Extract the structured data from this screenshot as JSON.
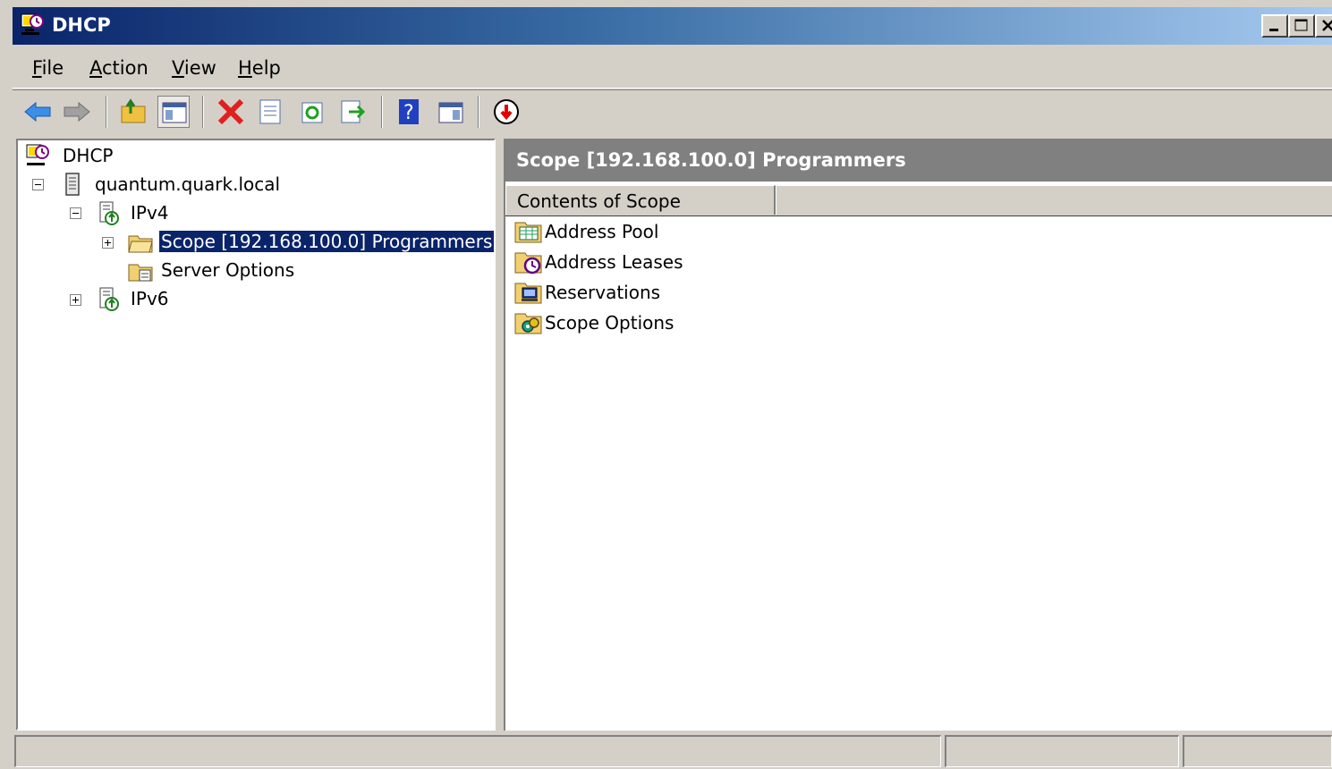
{
  "window": {
    "title": "DHCP"
  },
  "menu": [
    {
      "pre": "",
      "ul": "F",
      "post": "ile"
    },
    {
      "pre": "",
      "ul": "A",
      "post": "ction"
    },
    {
      "pre": "",
      "ul": "V",
      "post": "iew"
    },
    {
      "pre": "",
      "ul": "H",
      "post": "elp"
    }
  ],
  "tree": {
    "root": "DHCP",
    "server": "quantum.quark.local",
    "ipv4": "IPv4",
    "scope": "Scope [192.168.100.0] Programmers",
    "server_options": "Server Options",
    "ipv6": "IPv6"
  },
  "results": {
    "header": "Scope [192.168.100.0] Programmers",
    "column": "Contents of Scope",
    "items": [
      {
        "label": "Address Pool",
        "icon": "address-pool-icon"
      },
      {
        "label": "Address Leases",
        "icon": "address-leases-icon"
      },
      {
        "label": "Reservations",
        "icon": "reservations-icon"
      },
      {
        "label": "Scope Options",
        "icon": "scope-options-icon"
      }
    ]
  },
  "colors": {
    "selection": "#0a246a",
    "title_start": "#0a246a",
    "title_end": "#a6caf0",
    "chrome": "#d4d0c8"
  }
}
